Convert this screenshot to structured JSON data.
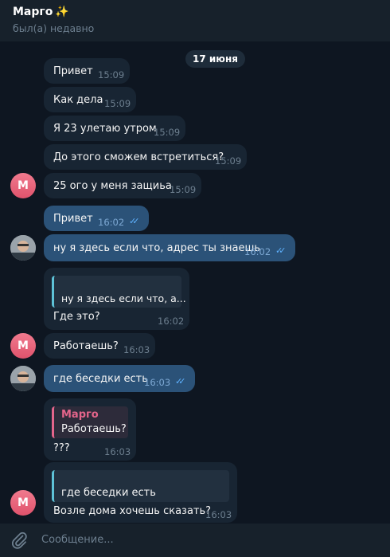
{
  "header": {
    "name": "Марго",
    "status": "был(а) недавно"
  },
  "date_separator": "17 июня",
  "messages": [
    {
      "text": "Привет",
      "time": "15:09"
    },
    {
      "text": "Как дела",
      "time": "15:09"
    },
    {
      "text": "Я 23 улетаю утром",
      "time": "15:09"
    },
    {
      "text": "До этого сможем встретиться?",
      "time": "15:09"
    },
    {
      "text": "25 ого у меня защиьа",
      "time": "15:09"
    },
    {
      "text": "Привет",
      "time": "16:02"
    },
    {
      "text": "ну я здесь если что, адрес ты знаешь",
      "time": "16:02"
    },
    {
      "quote": "ну я здесь если что, а...",
      "text": "Где это?",
      "time": "16:02"
    },
    {
      "text": "Работаешь?",
      "time": "16:03"
    },
    {
      "text": "где беседки есть",
      "time": "16:03"
    },
    {
      "quote_name": "Марго",
      "quote": "Работаешь?",
      "text": "???",
      "time": "16:03"
    },
    {
      "quote": "где беседки есть",
      "text": "Возле дома хочешь сказать?",
      "time": "16:03"
    }
  ],
  "avatar_letter": "М",
  "composer": {
    "placeholder": "Сообщение..."
  }
}
